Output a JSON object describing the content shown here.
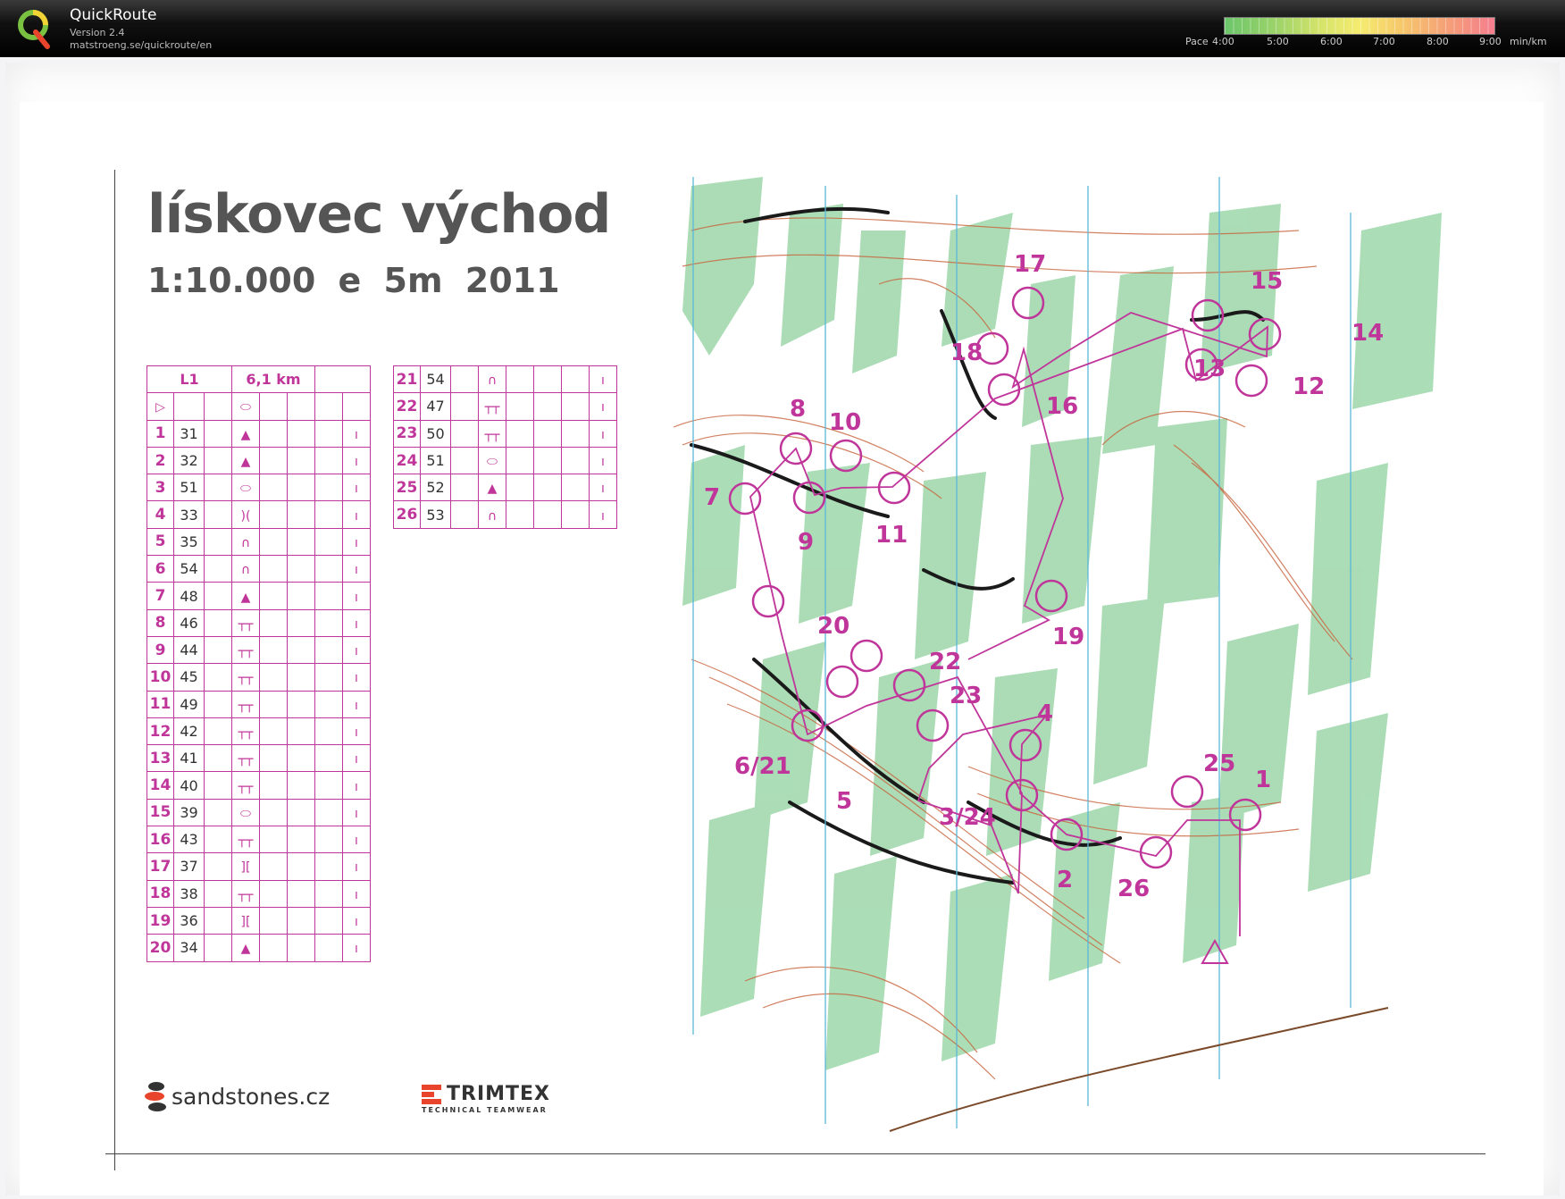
{
  "app": {
    "title": "QuickRoute",
    "version": "Version 2.4",
    "url": "matstroeng.se/quickroute/en",
    "logo_icon": "quickroute-q-logo"
  },
  "pace_legend": {
    "label": "Pace",
    "ticks": [
      "4:00",
      "5:00",
      "6:00",
      "7:00",
      "8:00",
      "9:00"
    ],
    "unit": "min/km",
    "colors": [
      "#6bc56b",
      "#d4e36a",
      "#f5ec70",
      "#f6c96b",
      "#f47f8e"
    ]
  },
  "map": {
    "title": "lískovec východ",
    "scale": "1:10.000",
    "contour": "e 5m",
    "year": "2011",
    "course_colour": "#c0359a",
    "course_name": "L1",
    "course_length": "6,1 km",
    "descriptions_left": [
      {
        "n": "1",
        "code": "31"
      },
      {
        "n": "2",
        "code": "32"
      },
      {
        "n": "3",
        "code": "51"
      },
      {
        "n": "4",
        "code": "33"
      },
      {
        "n": "5",
        "code": "35"
      },
      {
        "n": "6",
        "code": "54"
      },
      {
        "n": "7",
        "code": "48"
      },
      {
        "n": "8",
        "code": "46"
      },
      {
        "n": "9",
        "code": "44"
      },
      {
        "n": "10",
        "code": "45"
      },
      {
        "n": "11",
        "code": "49"
      },
      {
        "n": "12",
        "code": "42"
      },
      {
        "n": "13",
        "code": "41"
      },
      {
        "n": "14",
        "code": "40"
      },
      {
        "n": "15",
        "code": "39"
      },
      {
        "n": "16",
        "code": "43"
      },
      {
        "n": "17",
        "code": "37"
      },
      {
        "n": "18",
        "code": "38"
      },
      {
        "n": "19",
        "code": "36"
      },
      {
        "n": "20",
        "code": "34"
      }
    ],
    "descriptions_right": [
      {
        "n": "21",
        "code": "54"
      },
      {
        "n": "22",
        "code": "47"
      },
      {
        "n": "23",
        "code": "50"
      },
      {
        "n": "24",
        "code": "51"
      },
      {
        "n": "25",
        "code": "52"
      },
      {
        "n": "26",
        "code": "53"
      }
    ],
    "control_labels": [
      "17",
      "18",
      "16",
      "15",
      "14",
      "13",
      "12",
      "8",
      "10",
      "7",
      "9",
      "11",
      "20",
      "19",
      "22",
      "23",
      "4",
      "6/21",
      "5",
      "3/24",
      "25",
      "1",
      "2",
      "26"
    ],
    "sponsors": {
      "sandstones": "sandstones.cz",
      "trimtex": "TRIMTEX",
      "trimtex_sub": "TECHNICAL TEAMWEAR"
    }
  }
}
